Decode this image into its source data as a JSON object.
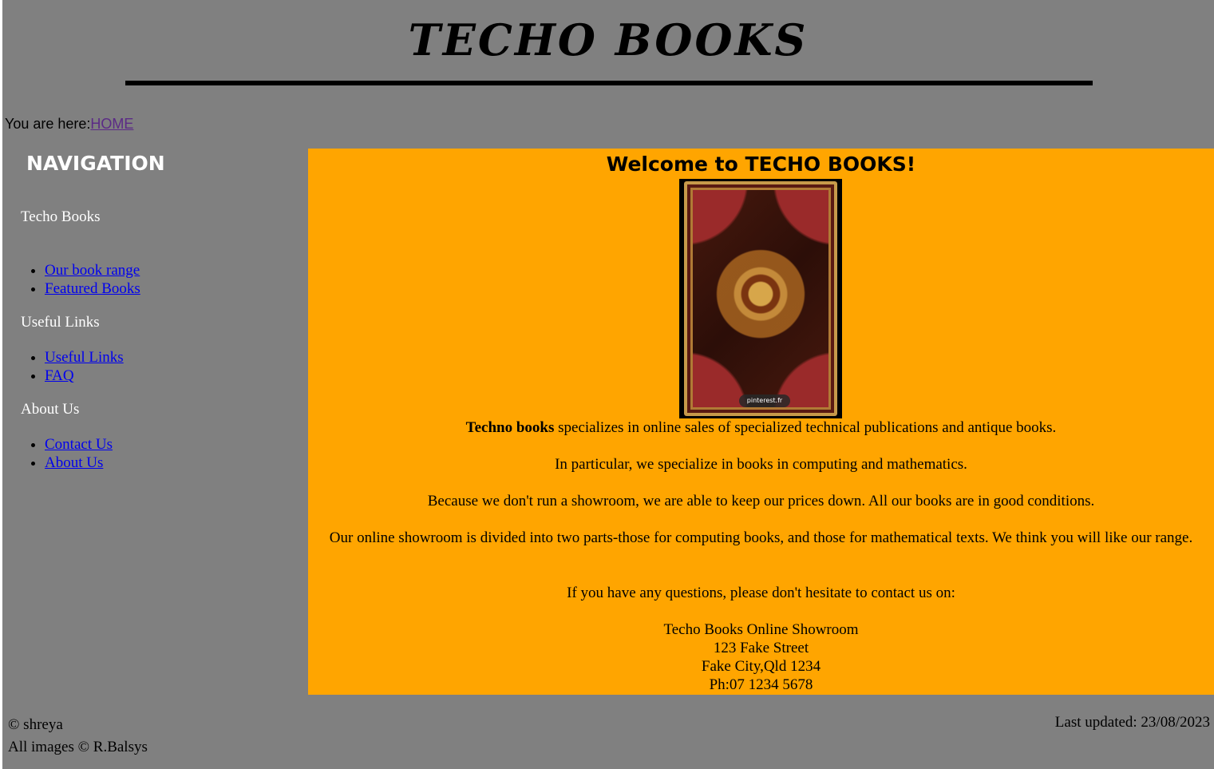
{
  "header": {
    "title": "TECHO BOOKS"
  },
  "breadcrumb": {
    "prefix": "You are here:",
    "home": "HOME"
  },
  "nav": {
    "title": "NAVIGATION",
    "sections": [
      {
        "heading": "Techo Books",
        "links": [
          "Our book range",
          "Featured Books"
        ]
      },
      {
        "heading": "Useful Links",
        "links": [
          "Useful Links",
          "FAQ"
        ]
      },
      {
        "heading": "About Us",
        "links": [
          "Contact Us",
          "About Us"
        ]
      }
    ]
  },
  "main": {
    "title": "Welcome to TECHO BOOKS!",
    "image_watermark": "pinterest.fr",
    "intro_bold": "Techno books",
    "intro_rest": " specializes in online sales of specialized technical publications and antique books.",
    "p2": "In particular, we specialize in books in computing and mathematics.",
    "p3": "Because we don't run a showroom, we are able to keep our prices down. All our books are in good conditions.",
    "p4": "Our online showroom is divided into two parts-those for computing books, and those for mathematical texts. We think you will like our range.",
    "p5": "If you have any questions, please don't hesitate to contact us on:",
    "address": [
      "Techo Books Online Showroom",
      "123 Fake Street",
      "Fake City,Qld 1234",
      "Ph:07 1234 5678"
    ]
  },
  "footer": {
    "copyright": "© shreya",
    "images": "All images © R.Balsys",
    "updated": "Last updated: 23/08/2023"
  },
  "colors": {
    "page_bg": "#808080",
    "content_bg": "#ffa500",
    "link": "#0000ee",
    "visited_link": "#5b2a86"
  }
}
